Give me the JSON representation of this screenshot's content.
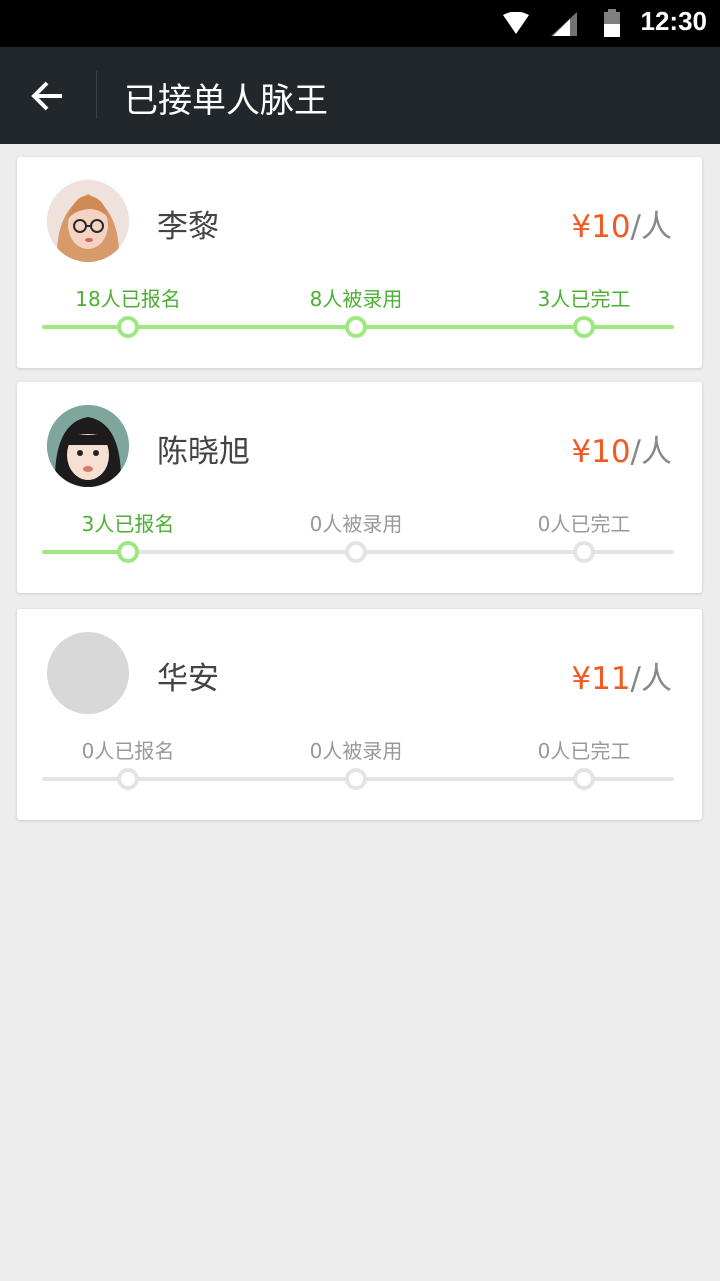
{
  "status_bar": {
    "time": "12:30"
  },
  "app_bar": {
    "title": "已接单人脉王",
    "back_icon": "arrow-left-icon"
  },
  "colors": {
    "accent_green": "#9ee882",
    "text_green": "#4caf32",
    "price_orange": "#f15a22",
    "app_bar_bg": "#21272b"
  },
  "cards": [
    {
      "name": "李黎",
      "price_amount": "¥10",
      "price_unit": "/人",
      "progress": 1.0,
      "steps": [
        {
          "label": "18人已报名",
          "done": true
        },
        {
          "label": "8人被录用",
          "done": true
        },
        {
          "label": "3人已完工",
          "done": true
        }
      ]
    },
    {
      "name": "陈晓旭",
      "price_amount": "¥10",
      "price_unit": "/人",
      "progress": 0.0,
      "steps": [
        {
          "label": "3人已报名",
          "done": true
        },
        {
          "label": "0人被录用",
          "done": false
        },
        {
          "label": "0人已完工",
          "done": false
        }
      ]
    },
    {
      "name": "华安",
      "price_amount": "¥11",
      "price_unit": "/人",
      "progress": 0.0,
      "steps": [
        {
          "label": "0人已报名",
          "done": false
        },
        {
          "label": "0人被录用",
          "done": false
        },
        {
          "label": "0人已完工",
          "done": false
        }
      ]
    }
  ]
}
